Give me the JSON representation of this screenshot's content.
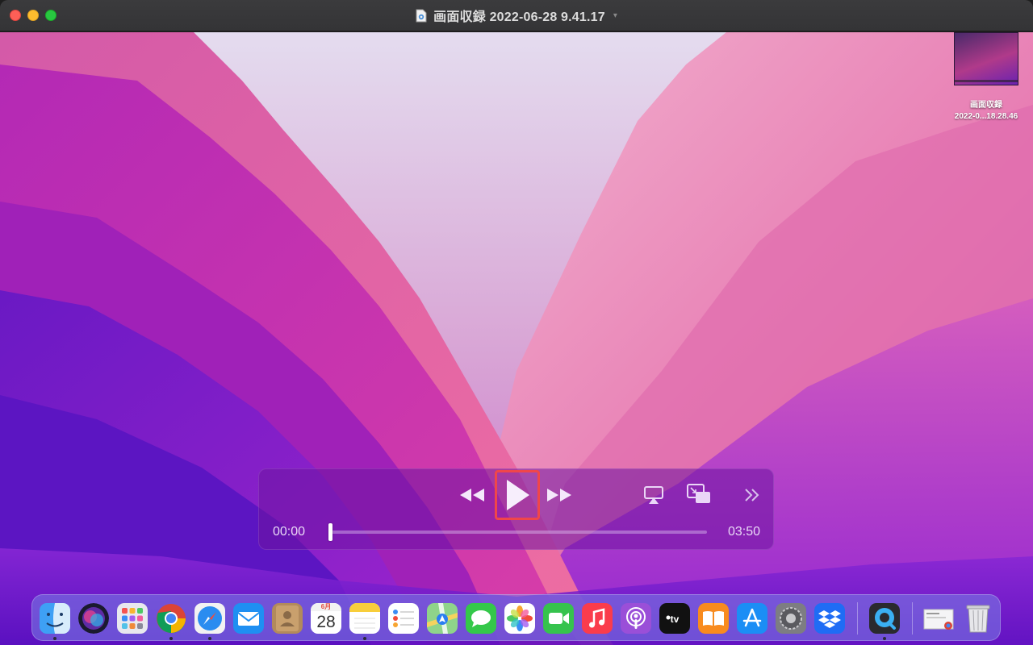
{
  "window": {
    "title": "画面収録 2022-06-28 9.41.17"
  },
  "desktop": {
    "file_label_line1": "画面収録",
    "file_label_line2": "2022-0...18.28.46"
  },
  "player": {
    "current_time": "00:00",
    "duration": "03:50",
    "progress": 0.0
  },
  "dock": {
    "calendar_month": "6月",
    "calendar_day": "28",
    "apps": [
      "Finder",
      "Siri",
      "Launchpad",
      "Google Chrome",
      "Safari",
      "Mail",
      "Contacts",
      "Calendar",
      "Notes",
      "Reminders",
      "Maps",
      "Messages",
      "Photos",
      "FaceTime",
      "Music",
      "Podcasts",
      "TV",
      "Books",
      "App Store",
      "System Preferences",
      "Dropbox",
      "QuickTime Player",
      "Downloads",
      "Trash"
    ]
  },
  "colors": {
    "accent_highlight": "#f0464a",
    "traffic_close": "#fe5f57",
    "traffic_minimize": "#febc2e",
    "traffic_maximize": "#28c840"
  }
}
